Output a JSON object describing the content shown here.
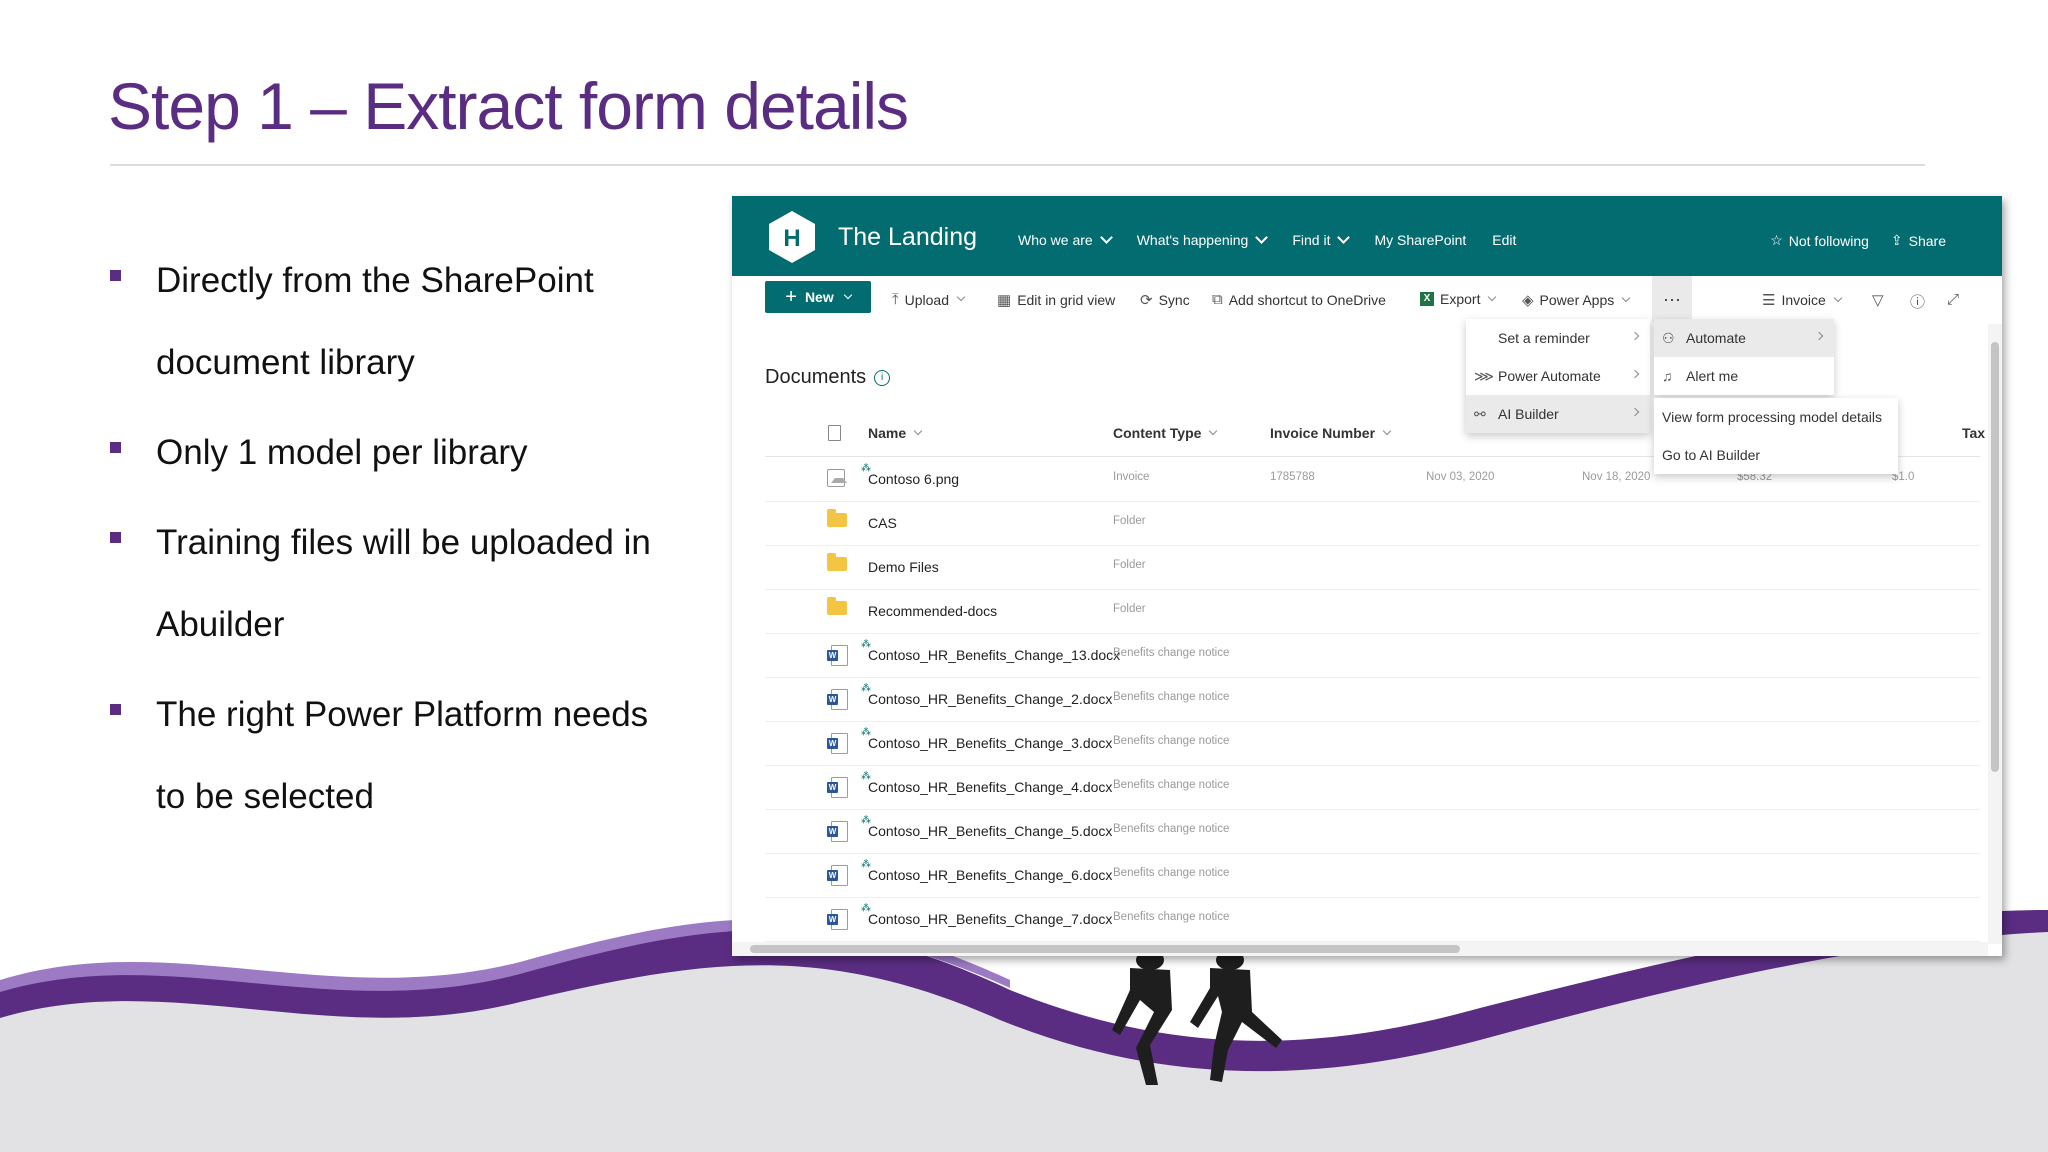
{
  "slide": {
    "title": "Step 1 – Extract form details",
    "bullets": [
      "Directly from the SharePoint document library",
      "Only 1 model per library",
      "Training files will be uploaded in Abuilder",
      "The right Power Platform needs to be selected"
    ]
  },
  "colors": {
    "title": "#5a2d82",
    "accent": "#036c70",
    "wave": "#5a2d82"
  },
  "site": {
    "logo_letter": "H",
    "title": "The Landing",
    "nav": [
      "Who we are",
      "What's happening",
      "Find it",
      "My SharePoint",
      "Edit"
    ],
    "follow": "Not following",
    "share": "Share"
  },
  "commands": {
    "new": "New",
    "upload": "Upload",
    "grid": "Edit in grid view",
    "sync": "Sync",
    "shortcut": "Add shortcut to OneDrive",
    "export": "Export",
    "power_apps": "Power Apps",
    "more": "···",
    "view": "Invoice"
  },
  "library": {
    "title": "Documents",
    "columns": {
      "name": "Name",
      "content_type": "Content Type",
      "invoice_number": "Invoice Number",
      "tax": "Tax"
    },
    "rows": [
      {
        "name": "Contoso 6.png",
        "icon": "image-icon",
        "type": "Invoice",
        "invoice": "1785788",
        "date": "Nov 03, 2020",
        "due": "Nov 18, 2020",
        "amount": "$58.32",
        "tax": "$1.0"
      },
      {
        "name": "CAS",
        "icon": "folder-icon",
        "type": "Folder"
      },
      {
        "name": "Demo Files",
        "icon": "folder-icon",
        "type": "Folder"
      },
      {
        "name": "Recommended-docs",
        "icon": "folder-icon",
        "type": "Folder"
      },
      {
        "name": "Contoso_HR_Benefits_Change_13.docx",
        "icon": "word-icon",
        "type": "Benefits change notice"
      },
      {
        "name": "Contoso_HR_Benefits_Change_2.docx",
        "icon": "word-icon",
        "type": "Benefits change notice"
      },
      {
        "name": "Contoso_HR_Benefits_Change_3.docx",
        "icon": "word-icon",
        "type": "Benefits change notice"
      },
      {
        "name": "Contoso_HR_Benefits_Change_4.docx",
        "icon": "word-icon",
        "type": "Benefits change notice"
      },
      {
        "name": "Contoso_HR_Benefits_Change_5.docx",
        "icon": "word-icon",
        "type": "Benefits change notice"
      },
      {
        "name": "Contoso_HR_Benefits_Change_6.docx",
        "icon": "word-icon",
        "type": "Benefits change notice"
      },
      {
        "name": "Contoso_HR_Benefits_Change_7.docx",
        "icon": "word-icon",
        "type": "Benefits change notice"
      }
    ]
  },
  "menus": {
    "main": [
      "Set a reminder",
      "Power Automate",
      "AI Builder"
    ],
    "automate": [
      "Automate",
      "Alert me"
    ],
    "ai_builder": [
      "View form processing model details",
      "Go to AI Builder"
    ]
  }
}
